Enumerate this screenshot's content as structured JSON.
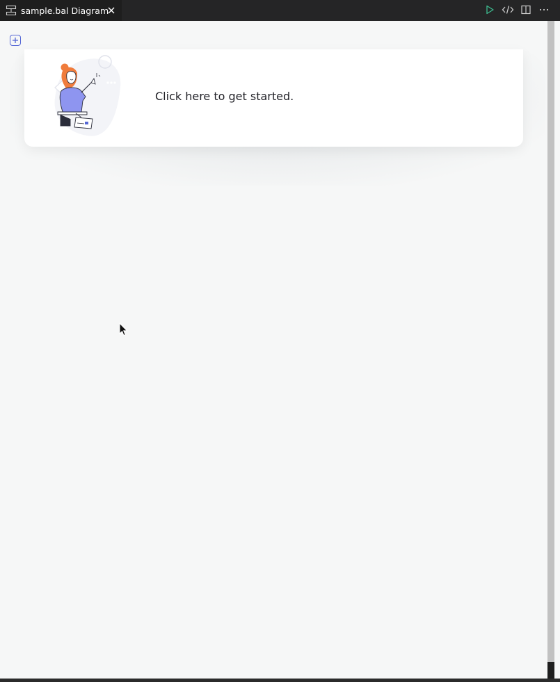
{
  "tab": {
    "title": "sample.bal Diagram",
    "icon": "diagram-icon"
  },
  "toolbar": {
    "actions": [
      "run-icon",
      "code-icon",
      "split-editor-icon",
      "more-icon"
    ],
    "run_color": "#3dbb8f"
  },
  "canvas": {
    "add_icon": "plus-square-icon",
    "accent": "#5567d5"
  },
  "welcome_card": {
    "text": "Click here to get started.",
    "illustration": "person-pointing-illustration"
  }
}
